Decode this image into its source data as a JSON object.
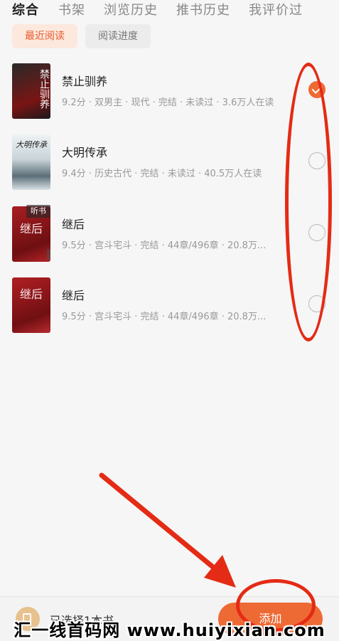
{
  "tabs": [
    {
      "label": "综合",
      "active": true
    },
    {
      "label": "书架",
      "active": false
    },
    {
      "label": "浏览历史",
      "active": false
    },
    {
      "label": "推书历史",
      "active": false
    },
    {
      "label": "我评价过",
      "active": false
    }
  ],
  "filters": [
    {
      "label": "最近阅读",
      "active": true
    },
    {
      "label": "阅读进度",
      "active": false
    }
  ],
  "books": [
    {
      "title": "禁止驯养",
      "meta": "9.2分 · 双男主 · 现代 · 完结 · 未读过 · 3.6万人在读",
      "cover_text": "禁止驯养",
      "selected": true
    },
    {
      "title": "大明传承",
      "meta": "9.4分 · 历史古代 · 完结 · 未读过 · 40.5万人在读",
      "cover_text": "大明传承",
      "selected": false
    },
    {
      "title": "继后",
      "meta": "9.5分 · 宫斗宅斗 · 完结 · 44章/496章 · 20.8万...",
      "cover_text": "继后",
      "badge": "听书",
      "selected": false
    },
    {
      "title": "继后",
      "meta": "9.5分 · 宫斗宅斗 · 完结 · 44章/496章 · 20.8万...",
      "cover_text": "继后",
      "selected": false
    }
  ],
  "bottom": {
    "selected_text": "已选择1本书",
    "add_label": "添加"
  },
  "watermark": "汇一线首码网 www.huiyixian.com",
  "colors": {
    "accent": "#ee6a35",
    "annotation": "#e42b15"
  }
}
